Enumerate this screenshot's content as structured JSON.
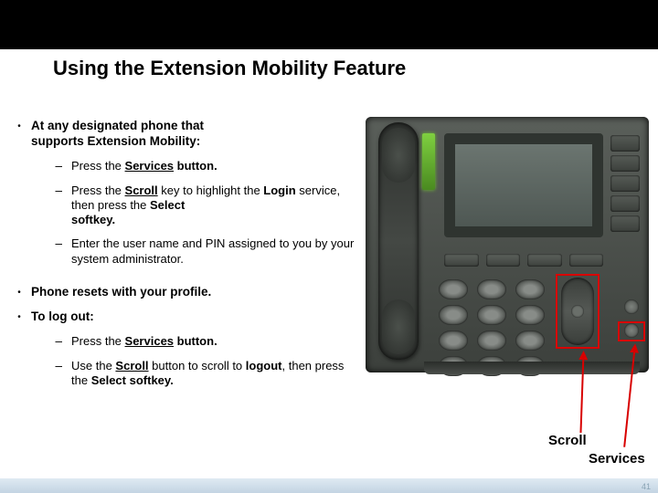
{
  "title": "Using the Extension Mobility Feature",
  "bullets": {
    "b1": {
      "lead_a": "At any designated phone that",
      "lead_b": "supports Extension Mobility:",
      "s1_a": "Press the ",
      "s1_b": "Services",
      "s1_c": " button.",
      "s2_a": "Press the ",
      "s2_b": "Scroll",
      "s2_c": " key to highlight the ",
      "s2_d": "Login",
      "s2_e": " service, then press the ",
      "s2_f": "Select",
      "s2_g": "softkey.",
      "s3": "Enter the user name and PIN assigned to you by your system administrator."
    },
    "b2": "Phone resets with your profile.",
    "b3": {
      "lead": "To log out:",
      "s1_a": "Press the ",
      "s1_b": "Services",
      "s1_c": " button.",
      "s2_a": "Use the ",
      "s2_b": "Scroll",
      "s2_c": " button to scroll to ",
      "s2_d": "logout",
      "s2_e": ", then press the  ",
      "s2_f": "Select",
      "s2_g": " softkey."
    }
  },
  "labels": {
    "scroll": "Scroll",
    "services": "Services"
  },
  "page": "41"
}
